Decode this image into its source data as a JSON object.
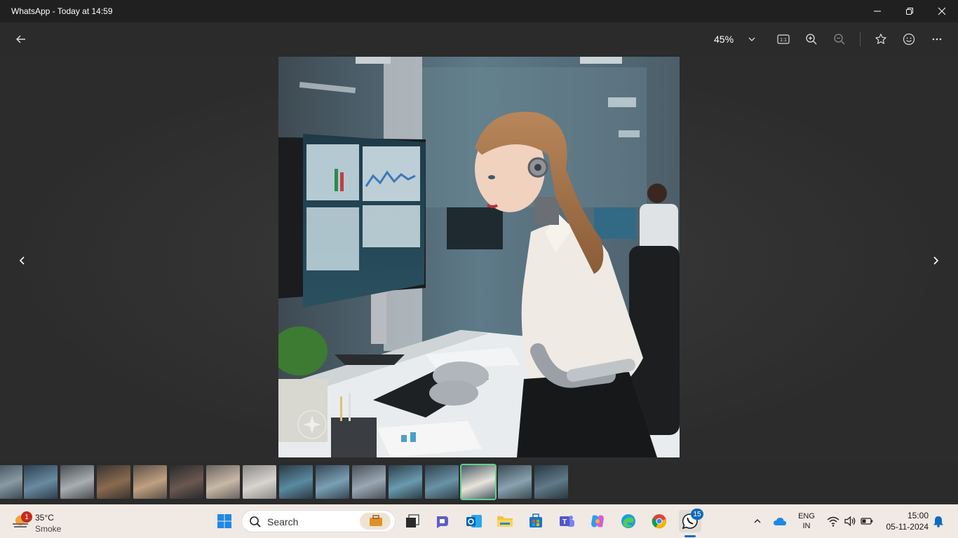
{
  "window": {
    "title": "WhatsApp - Today at 14:59"
  },
  "toolbar": {
    "zoom_level": "45%"
  },
  "taskbar": {
    "weather": {
      "badge": "1",
      "temp": "35°C",
      "desc": "Smoke"
    },
    "search_label": "Search",
    "whatsapp_badge": "15",
    "lang_line1": "ENG",
    "lang_line2": "IN",
    "time": "15:00",
    "date": "05-11-2024"
  },
  "filmstrip": {
    "selected_index": 13,
    "count": 16
  },
  "colors": {
    "accent_green": "#5fd18a",
    "close_red": "#c42b1c",
    "taskbar_bg": "#f1e9e4"
  }
}
